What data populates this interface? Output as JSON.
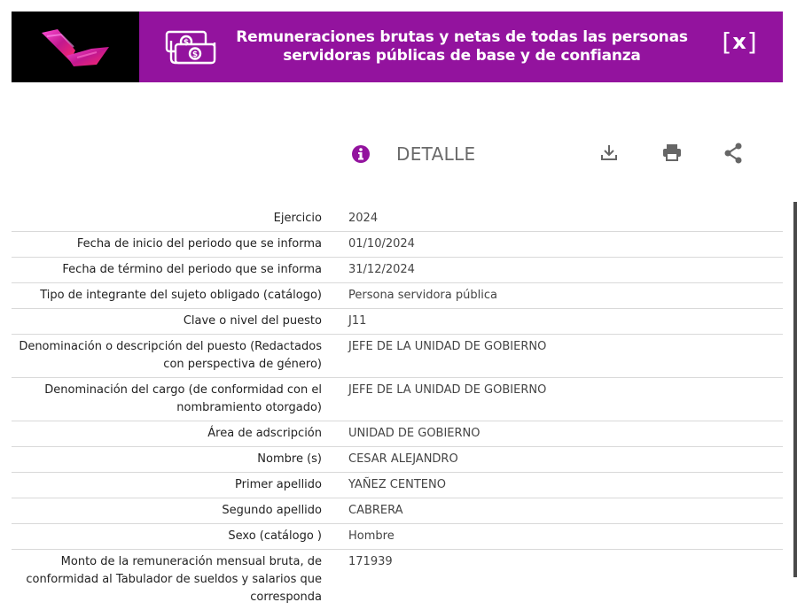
{
  "header": {
    "logo": "brand-logo",
    "money_icon": "money-bills-icon",
    "title": "Remuneraciones brutas y netas de todas las personas servidoras públicas de base y de confianza",
    "close_label": "x"
  },
  "toolbar": {
    "info_icon": "info-icon",
    "detail_label": "DETALLE",
    "download_icon": "download-icon",
    "print_icon": "print-icon",
    "share_icon": "share-icon"
  },
  "colors": {
    "brand_purple": "#93139e",
    "logo_bg": "#000000"
  },
  "fields": [
    {
      "label": "Ejercicio",
      "value": "2024"
    },
    {
      "label": "Fecha de inicio del periodo que se informa",
      "value": "01/10/2024"
    },
    {
      "label": "Fecha de término del periodo que se informa",
      "value": "31/12/2024"
    },
    {
      "label": "Tipo de integrante del sujeto obligado (catálogo)",
      "value": "Persona servidora pública"
    },
    {
      "label": "Clave o nivel del puesto",
      "value": "J11"
    },
    {
      "label": "Denominación o descripción del puesto (Redactados con perspectiva de género)",
      "value": "JEFE DE LA UNIDAD DE GOBIERNO"
    },
    {
      "label": "Denominación del cargo (de conformidad con el nombramiento otorgado)",
      "value": "JEFE DE LA UNIDAD DE GOBIERNO"
    },
    {
      "label": "Área de adscripción",
      "value": "UNIDAD DE GOBIERNO"
    },
    {
      "label": "Nombre (s)",
      "value": "CESAR ALEJANDRO"
    },
    {
      "label": "Primer apellido",
      "value": "YAÑEZ CENTENO"
    },
    {
      "label": "Segundo apellido",
      "value": "CABRERA"
    },
    {
      "label": "Sexo (catálogo )",
      "value": "Hombre"
    },
    {
      "label": "Monto de la remuneración mensual bruta, de conformidad al Tabulador de sueldos y salarios que corresponda",
      "value": "171939"
    }
  ]
}
